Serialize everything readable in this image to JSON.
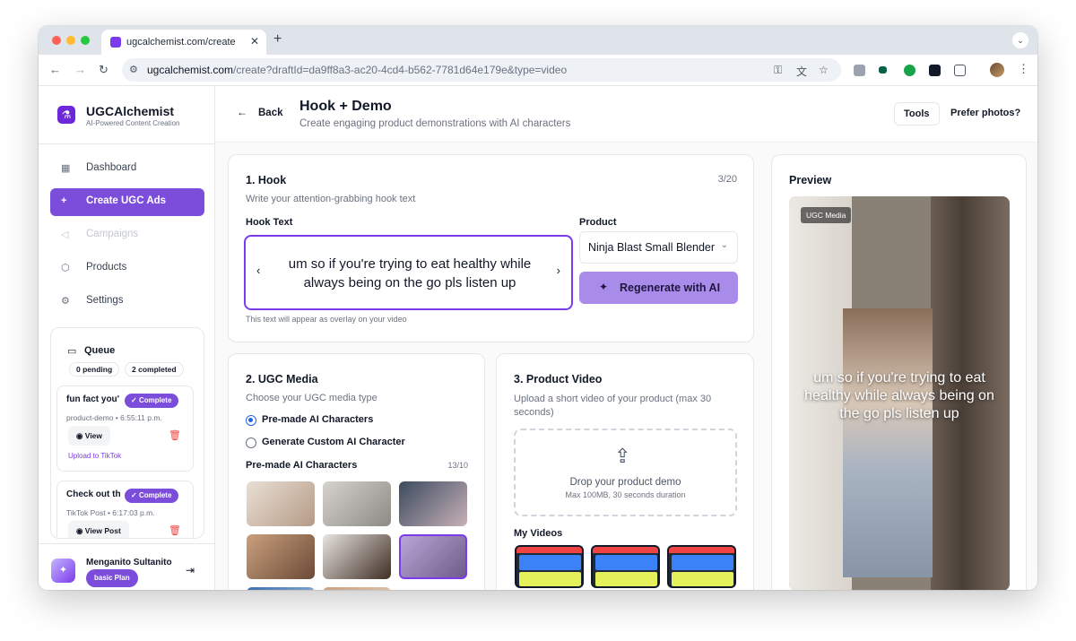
{
  "browser": {
    "tab_title": "ugcalchemist.com/create",
    "tab_close": "✕",
    "new_tab": "+",
    "url_host": "ugcalchemist.com",
    "url_path": "/create?draftId=da9ff8a3-ac20-4cd4-b562-7781d64e179e&type=video"
  },
  "sidebar": {
    "brand": "UGCAlchemist",
    "tagline": "AI-Powered Content Creation",
    "nav": [
      {
        "label": "Dashboard",
        "icon": "grid-icon",
        "state": "normal"
      },
      {
        "label": "Create UGC Ads",
        "icon": "plus-icon",
        "state": "active"
      },
      {
        "label": "Campaigns",
        "icon": "megaphone-icon",
        "state": "disabled"
      },
      {
        "label": "Products",
        "icon": "box-icon",
        "state": "normal"
      },
      {
        "label": "Settings",
        "icon": "gear-icon",
        "state": "normal"
      }
    ],
    "queue": {
      "title": "Queue",
      "pending": "0 pending",
      "completed": "2 completed",
      "items": [
        {
          "title": "fun fact you'",
          "status": "Complete",
          "meta": "product-demo • 6:55:11 p.m.",
          "view": "View",
          "link": "Upload to TikTok"
        },
        {
          "title": "Check out th",
          "status": "Complete",
          "meta": "TikTok Post • 6:17:03 p.m.",
          "view": "View Post",
          "link": ""
        }
      ]
    },
    "user": {
      "name": "Menganito Sultanito",
      "plan": "basic Plan"
    }
  },
  "header": {
    "back": "Back",
    "title": "Hook + Demo",
    "subtitle": "Create engaging product demonstrations with AI characters",
    "tools": "Tools",
    "photos": "Prefer photos?"
  },
  "hook": {
    "title": "1. Hook",
    "subtitle": "Write your attention-grabbing hook text",
    "count": "3/20",
    "text_label": "Hook Text",
    "text": "um so if you're trying to eat healthy while always being on the go pls listen up",
    "hint": "This text will appear as overlay on your video",
    "product_label": "Product",
    "product_value": "Ninja Blast Small Blender",
    "regenerate": "Regenerate with AI"
  },
  "media": {
    "title": "2. UGC Media",
    "subtitle": "Choose your UGC media type",
    "options": [
      {
        "label": "Pre-made AI Characters",
        "checked": true
      },
      {
        "label": "Generate Custom AI Character",
        "checked": false
      }
    ],
    "chars_label": "Pre-made AI Characters",
    "chars_count": "13/10"
  },
  "product_video": {
    "title": "3. Product Video",
    "subtitle": "Upload a short video of your product (max 30 seconds)",
    "drop_title": "Drop your product demo",
    "drop_sub": "Max 100MB, 30 seconds duration",
    "my_videos": "My Videos"
  },
  "preview": {
    "title": "Preview",
    "tag": "UGC Media",
    "overlay": "um so if you're trying to eat healthy while always being on the go pls listen up"
  },
  "colors": {
    "accent": "#7c4ddb",
    "accent_light": "#a98bea",
    "danger": "#ef4444"
  }
}
